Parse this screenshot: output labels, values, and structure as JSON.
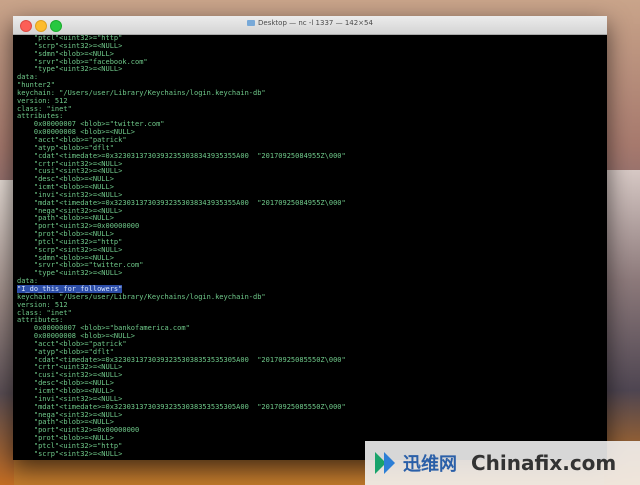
{
  "window": {
    "title": "Desktop — nc -l 1337 — 142×54"
  },
  "terminal": {
    "lines": [
      "    \"ptcl\"<uint32>=\"http\"",
      "    \"scrp\"<sint32>=<NULL>",
      "    \"sdmn\"<blob>=<NULL>",
      "    \"srvr\"<blob>=\"facebook.com\"",
      "    \"type\"<uint32>=<NULL>",
      "data:",
      "\"hunter2\"",
      "keychain: \"/Users/user/Library/Keychains/login.keychain-db\"",
      "version: 512",
      "class: \"inet\"",
      "attributes:",
      "    0x00000007 <blob>=\"twitter.com\"",
      "    0x00000008 <blob>=<NULL>",
      "    \"acct\"<blob>=\"patrick\"",
      "    \"atyp\"<blob>=\"dflt\"",
      "    \"cdat\"<timedate>=0x32303137303932353038343935355A00  \"20170925084955Z\\000\"",
      "    \"crtr\"<uint32>=<NULL>",
      "    \"cusi\"<sint32>=<NULL>",
      "    \"desc\"<blob>=<NULL>",
      "    \"icmt\"<blob>=<NULL>",
      "    \"invi\"<sint32>=<NULL>",
      "    \"mdat\"<timedate>=0x32303137303932353038343935355A00  \"20170925084955Z\\000\"",
      "    \"nega\"<sint32>=<NULL>",
      "    \"path\"<blob>=<NULL>",
      "    \"port\"<uint32>=0x00000000",
      "    \"prot\"<blob>=<NULL>",
      "    \"ptcl\"<uint32>=\"http\"",
      "    \"scrp\"<sint32>=<NULL>",
      "    \"sdmn\"<blob>=<NULL>",
      "    \"srvr\"<blob>=\"twitter.com\"",
      "    \"type\"<uint32>=<NULL>",
      "data:"
    ],
    "highlighted": "\"I_do_this_for_followers\"",
    "lines_after": [
      "keychain: \"/Users/user/Library/Keychains/login.keychain-db\"",
      "version: 512",
      "class: \"inet\"",
      "attributes:",
      "    0x00000007 <blob>=\"bankofamerica.com\"",
      "    0x00000008 <blob>=<NULL>",
      "    \"acct\"<blob>=\"patrick\"",
      "    \"atyp\"<blob>=\"dflt\"",
      "    \"cdat\"<timedate>=0x32303137303932353038353535305A00  \"20170925085550Z\\000\"",
      "    \"crtr\"<uint32>=<NULL>",
      "    \"cusi\"<sint32>=<NULL>",
      "    \"desc\"<blob>=<NULL>",
      "    \"icmt\"<blob>=<NULL>",
      "    \"invi\"<sint32>=<NULL>",
      "    \"mdat\"<timedate>=0x32303137303932353038353535305A00  \"20170925085550Z\\000\"",
      "    \"nega\"<sint32>=<NULL>",
      "    \"path\"<blob>=<NULL>",
      "    \"port\"<uint32>=0x00000000",
      "    \"prot\"<blob>=<NULL>",
      "    \"ptcl\"<uint32>=\"http\"",
      "    \"scrp\"<sint32>=<NULL>"
    ]
  },
  "watermark": {
    "cn": "迅维网",
    "en": "Chinafix.com"
  },
  "colors": {
    "text": "#6fc98a",
    "highlight": "#2d4ea8",
    "background": "#000000"
  }
}
